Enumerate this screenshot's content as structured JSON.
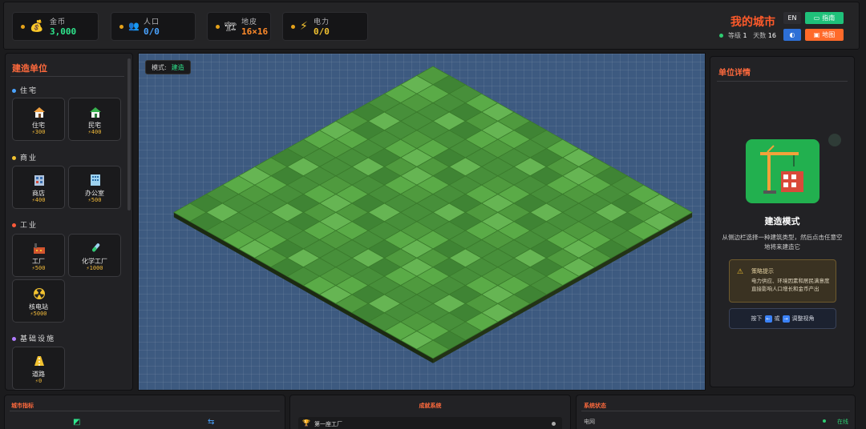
{
  "topbar": {
    "stats": [
      {
        "label": "金币",
        "value": "3,000",
        "icon": "money-bag-icon",
        "color": "#2ee58c"
      },
      {
        "label": "人口",
        "value": "0/0",
        "icon": "people-icon",
        "color": "#4aa3ff"
      },
      {
        "label": "地皮",
        "value": "16×16",
        "icon": "land-icon",
        "color": "#ff8a2a"
      },
      {
        "label": "电力",
        "value": "0/0",
        "icon": "lightning-icon",
        "color": "#f2c230"
      }
    ],
    "city_name": "我的城市",
    "level_label": "等级",
    "level_value": "1",
    "days_label": "天数",
    "days_value": "16",
    "lang_button": "EN",
    "guide_button": "指南",
    "reset_button": "地图"
  },
  "build_panel": {
    "title": "建造单位",
    "categories": [
      {
        "name": "住宅",
        "color": "#4aa3ff",
        "items": [
          {
            "name": "住宅",
            "cost": "⚡300",
            "icon": "house-icon"
          },
          {
            "name": "民宅",
            "cost": "⚡400",
            "icon": "house-green-icon"
          }
        ]
      },
      {
        "name": "商业",
        "color": "#f2c230",
        "items": [
          {
            "name": "商店",
            "cost": "⚡400",
            "icon": "shop-icon"
          },
          {
            "name": "办公室",
            "cost": "⚡500",
            "icon": "office-icon"
          }
        ]
      },
      {
        "name": "工业",
        "color": "#ff5a3a",
        "items": [
          {
            "name": "工厂",
            "cost": "⚡500",
            "icon": "factory-icon"
          },
          {
            "name": "化学工厂",
            "cost": "⚡1000",
            "icon": "test-tube-icon"
          },
          {
            "name": "核电站",
            "cost": "⚡5000",
            "icon": "radiation-icon"
          }
        ]
      },
      {
        "name": "基础设施",
        "color": "#b07cff",
        "items": [
          {
            "name": "道路",
            "cost": "⚡0",
            "icon": "road-icon"
          }
        ]
      }
    ]
  },
  "map": {
    "mode_label": "模式:",
    "mode_value": "建造",
    "grid_size": 16,
    "tile_colors": [
      "#4f9a3e",
      "#5aab47",
      "#3f8434",
      "#66b553",
      "#478f3a"
    ]
  },
  "detail_panel": {
    "title": "单位详情",
    "icon": "construction-crane-icon",
    "mode_title": "建造模式",
    "description": "从侧边栏选择一种建筑类型，然后点击任意空地将来建造它",
    "tip_title": "策略提示",
    "tip_body": "电力供应、环境因素和居民满意度直接影响人口增长和金币产出",
    "keys_prefix": "按下",
    "key_a": "←",
    "keys_or": "或",
    "key_b": "→",
    "keys_suffix": "调整视角"
  },
  "bottom": {
    "metrics_title": "城市指标",
    "achievements_title": "成就系统",
    "achievement_first": "第一座工厂",
    "status_title": "系统状态",
    "status_item": "电网",
    "status_value": "在线"
  }
}
